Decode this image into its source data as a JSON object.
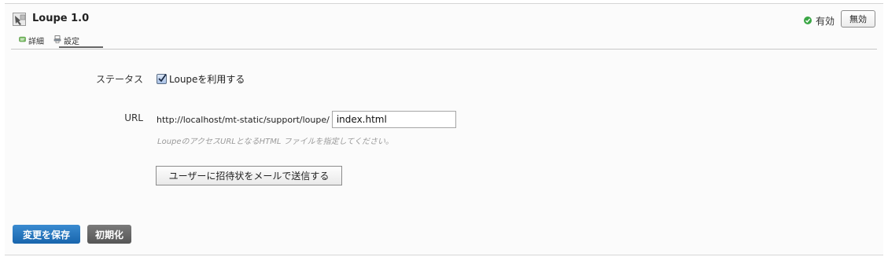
{
  "plugin": {
    "title": "Loupe 1.0",
    "icon": "plugin-icon",
    "status_label": "有効",
    "status_color": "#3aa645",
    "disable_button": "無効"
  },
  "tabs": [
    {
      "label": "詳細",
      "icon": "details-icon"
    },
    {
      "label": "設定",
      "icon": "settings-icon",
      "active": true
    }
  ],
  "form": {
    "status_label": "ステータス",
    "checkbox_label": "Loupeを利用する",
    "checkbox_checked": true,
    "url_label": "URL",
    "url_prefix": "http://localhost/mt-static/support/loupe/",
    "url_value": "index.html",
    "url_hint": "LoupeのアクセスURLとなるHTML ファイルを指定してください。",
    "invite_button": "ユーザーに招待状をメールで送信する"
  },
  "footer": {
    "save_button": "変更を保存",
    "reset_button": "初期化",
    "save_color": "#1f6fb8",
    "reset_color": "#666666"
  }
}
